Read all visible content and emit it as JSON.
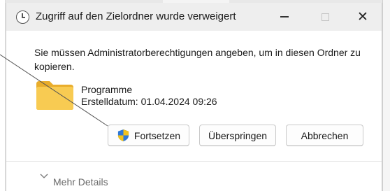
{
  "dialog": {
    "title": "Zugriff auf den Zielordner wurde verweigert",
    "window_controls": [
      "minimize",
      "maximize",
      "close"
    ],
    "message": "Sie müssen Administratorberechtigungen angeben, um in diesen Ordner zu kopieren.",
    "item": {
      "name": "Programme",
      "date": "Erstelldatum: 01.04.2024 09:26",
      "icon": "folder-icon"
    },
    "buttons": {
      "continue": "Fortsetzen",
      "skip": "Überspringen",
      "cancel": "Abbrechen"
    },
    "details": "Mehr Details"
  },
  "colors": {
    "titlebar": "#eeeeee",
    "folder": "#f5c444",
    "shield_blue": "#2f78d6",
    "shield_yellow": "#f2c21b"
  }
}
